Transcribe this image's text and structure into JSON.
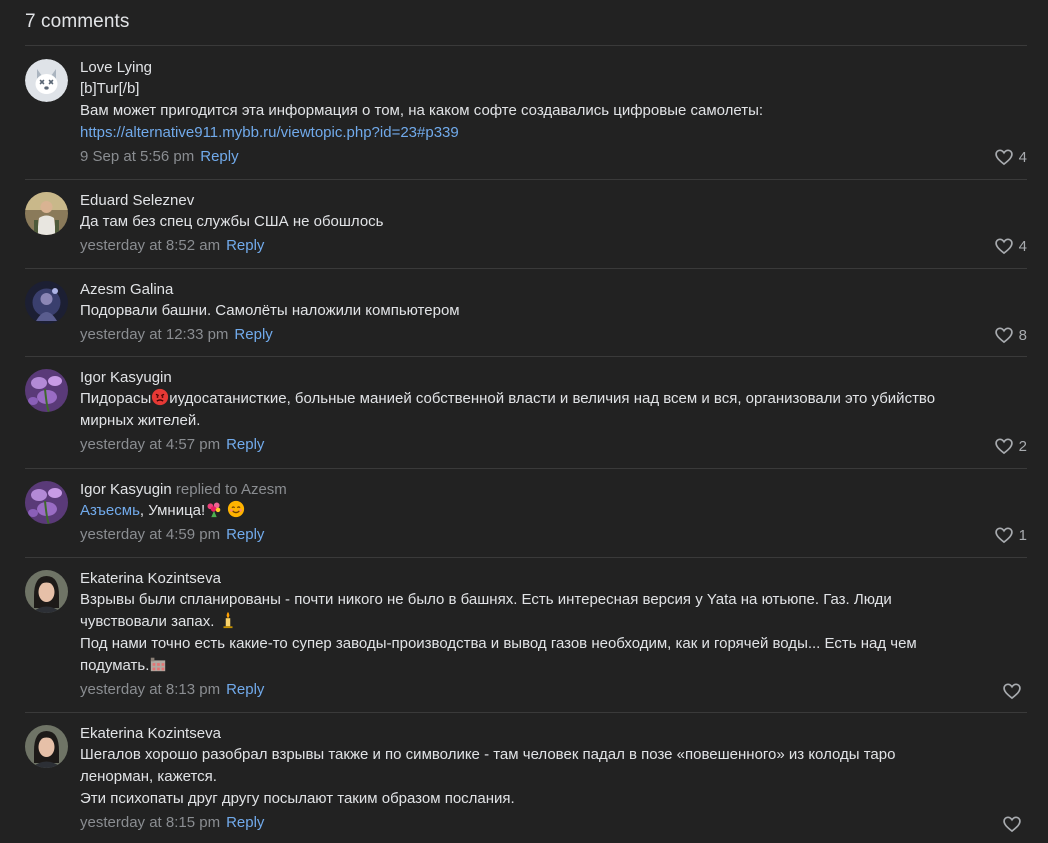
{
  "header": {
    "title": "7 comments"
  },
  "reply_label": "Reply",
  "comments": [
    {
      "author": "Love Lying",
      "lines": [
        "[b]Tur[/b]",
        "Вам может пригодится эта информация о том, на каком софте создавались цифровые самолеты:"
      ],
      "link": "https://alternative911.mybb.ru/viewtopic.php?id=23#p339",
      "time": "9 Sep at 5:56 pm",
      "likes": "4",
      "avatar": "default-dog-avatar"
    },
    {
      "author": "Eduard Seleznev",
      "lines": [
        "Да там без спец службы США не обошлось"
      ],
      "time": "yesterday at 8:52 am",
      "likes": "4",
      "avatar": "photo-avatar-man"
    },
    {
      "author": "Azesm Galina",
      "lines": [
        "Подорвали башни. Самолёты наложили компьютером"
      ],
      "time": "yesterday at 12:33 pm",
      "likes": "8",
      "avatar": "photo-avatar-dark"
    },
    {
      "author": "Igor Kasyugin",
      "lines": [
        "Пидорасы",
        "иудосатанисткие, больные манией собственной власти и величия над всем и вся, организовали это убийство",
        "мирных жителей."
      ],
      "time": "yesterday at 4:57 pm",
      "likes": "2",
      "avatar": "photo-avatar-purple"
    },
    {
      "author": "Igor Kasyugin",
      "replied_to": "replied to Azesm",
      "mention": "Азъесмь",
      "text_after": ", Умница!",
      "time": "yesterday at 4:59 pm",
      "likes": "1",
      "avatar": "photo-avatar-purple"
    },
    {
      "author": "Ekaterina Kozintseva",
      "lines": [
        "Взрывы были спланированы - почти никого не было в башнях. Есть интересная версия у Yata на ютьюпе. Газ. Люди",
        "чувствовали запах.",
        "Под нами точно есть какие-то супер заводы-производства и вывод газов необходим, как и горячей воды... Есть над чем",
        "подумать."
      ],
      "time": "yesterday at 8:13 pm",
      "likes": "",
      "avatar": "photo-avatar-woman"
    },
    {
      "author": "Ekaterina Kozintseva",
      "lines": [
        "Шегалов хорошо разобрал взрывы также и по символике - там человек падал в позе «повешенного» из колоды таро",
        "ленорман, кажется.",
        "Эти психопаты друг другу посылают таким образом послания."
      ],
      "time": "yesterday at 8:15 pm",
      "likes": "",
      "avatar": "photo-avatar-woman"
    }
  ],
  "colors": {
    "background": "#222222",
    "text": "#e1e3e6",
    "muted": "#8a8d91",
    "link": "#71aaeb",
    "divider": "#3a3a3a"
  }
}
